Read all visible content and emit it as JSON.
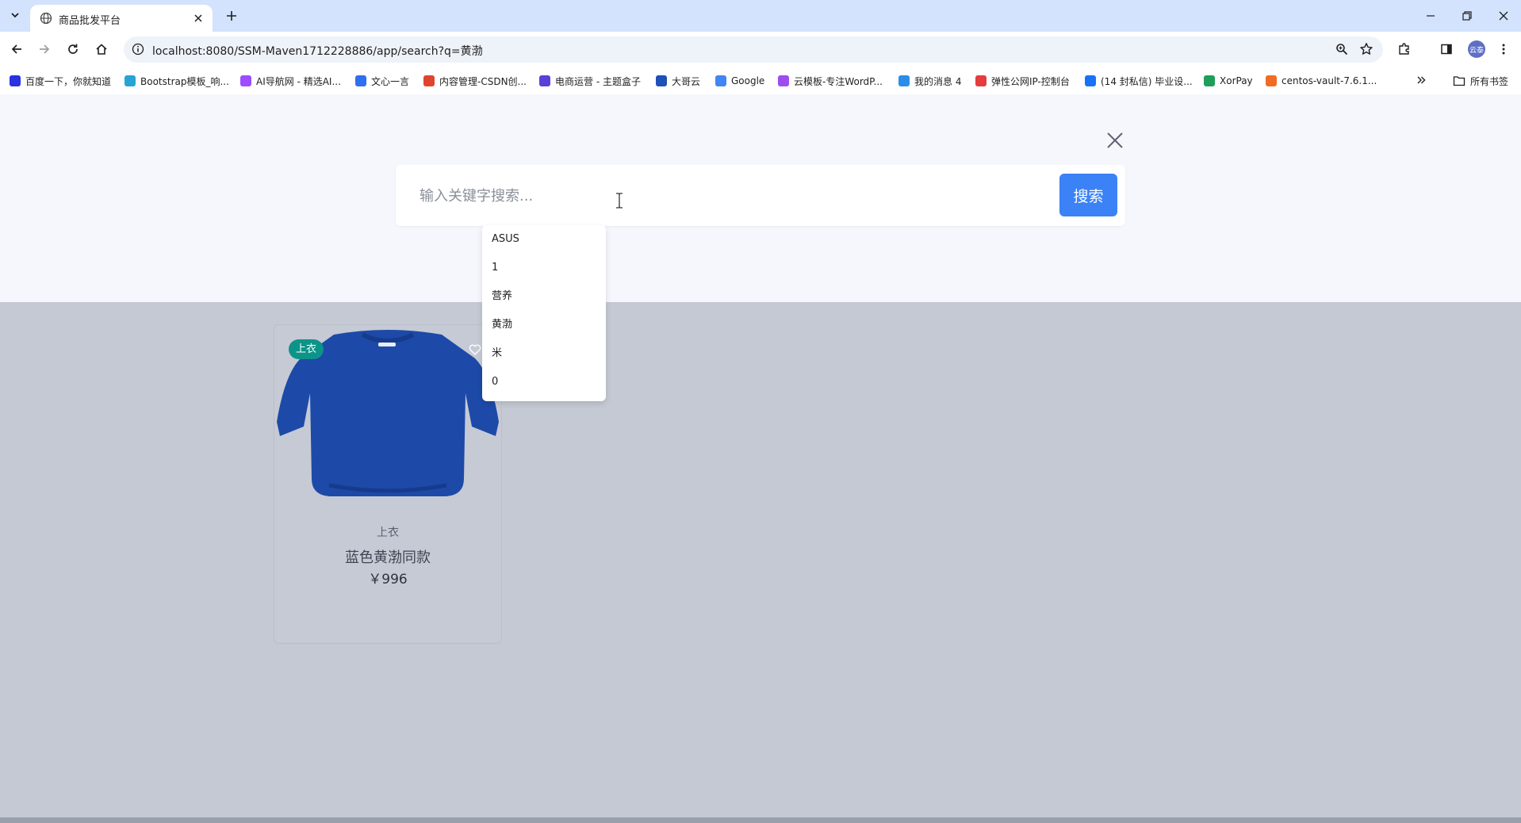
{
  "browser": {
    "tab": {
      "title": "商品批发平台",
      "favicon": "globe-icon"
    },
    "address": {
      "url": "localhost:8080/SSM-Maven1712228886/app/search?q=黄渤"
    },
    "profile_avatar_text": "云泰",
    "bookmarks": [
      {
        "label": "百度一下，你就知道",
        "color": "#2932e1"
      },
      {
        "label": "Bootstrap模板_响...",
        "color": "#29a3d4"
      },
      {
        "label": "AI导航网 - 精选AI...",
        "color": "#9b4dff"
      },
      {
        "label": "文心一言",
        "color": "#2f6ff0"
      },
      {
        "label": "内容管理-CSDN创...",
        "color": "#e0442e"
      },
      {
        "label": "电商运营 - 主题盒子",
        "color": "#5b3fd9"
      },
      {
        "label": "大哥云",
        "color": "#1f4fb8"
      },
      {
        "label": "Google",
        "color": "#4285f4"
      },
      {
        "label": "云模板-专注WordP...",
        "color": "#9e4cf0"
      },
      {
        "label": "我的消息 4",
        "color": "#2c8de8"
      },
      {
        "label": "弹性公网IP-控制台",
        "color": "#e33d3d"
      },
      {
        "label": "(14 封私信) 毕业设...",
        "color": "#1772f6"
      },
      {
        "label": "XorPay",
        "color": "#1e9e5a"
      },
      {
        "label": "centos-vault-7.6.1...",
        "color": "#f06c24"
      }
    ],
    "all_bookmarks_label": "所有书签"
  },
  "search": {
    "placeholder": "输入关键字搜索...",
    "button_label": "搜索",
    "suggestions": [
      "ASUS",
      "1",
      "营养",
      "黄渤",
      "米",
      "0"
    ]
  },
  "products": [
    {
      "category_badge": "上衣",
      "category": "上衣",
      "name": "蓝色黄渤同款",
      "price": "￥996",
      "image": "blue-sweatshirt"
    }
  ],
  "colors": {
    "accent": "#3b82f6",
    "badge": "#0d9488",
    "overlay_bg": "#c5c9d3",
    "panel_bg": "#f5f7fd",
    "product": "#1d4aa8"
  }
}
